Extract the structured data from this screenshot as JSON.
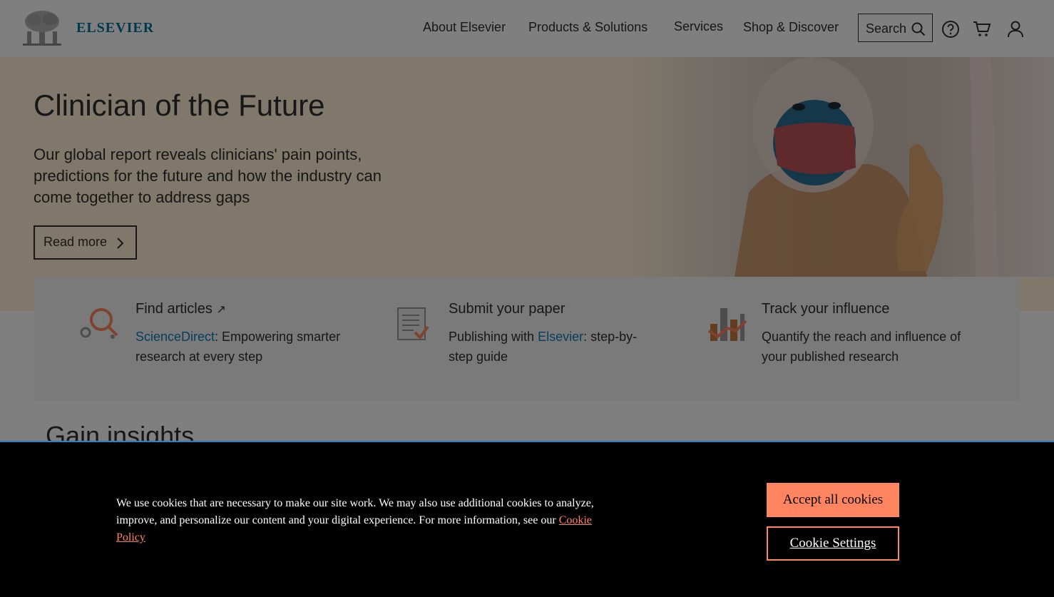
{
  "header": {
    "logo_text": "ELSEVIER",
    "nav": [
      "About Elsevier",
      "Products & Solutions",
      "Services",
      "Shop & Discover"
    ],
    "search_label": "Search",
    "icons": [
      "help-icon",
      "cart-icon",
      "user-icon"
    ]
  },
  "hero": {
    "title": "Clinician of the Future",
    "subtitle": "Our global report reveals clinicians' pain points, predictions for the future and how the industry can come together to address gaps",
    "button_label": "Read more"
  },
  "quick_links": [
    {
      "title": "Find articles",
      "link_text": "ScienceDirect",
      "pre": "",
      "post": ": Empowering smarter research at every step",
      "icon": "search-articles-icon"
    },
    {
      "title": "Submit your paper",
      "pre": "Publishing with ",
      "link_text": "Elsevier",
      "post": ": step-by-step guide",
      "icon": "submit-paper-icon"
    },
    {
      "title": "Track your influence",
      "pre": "",
      "link_text": "",
      "post": "Quantify the reach and influence of your published research",
      "icon": "chart-influence-icon"
    }
  ],
  "section": {
    "heading": "Gain insights"
  },
  "cookie": {
    "text": "We use cookies that are necessary to make our site work. We may also use additional cookies to analyze, improve, and personalize our content and your digital experience. For more information, see our ",
    "link": "Cookie Policy",
    "accept_label": "Accept all cookies",
    "settings_label": "Cookie Settings"
  },
  "colors": {
    "brand": "#007398",
    "accent_orange": "#ff8560",
    "link_blue": "#0c7dbb",
    "hero_bg": "#fff1d6"
  }
}
